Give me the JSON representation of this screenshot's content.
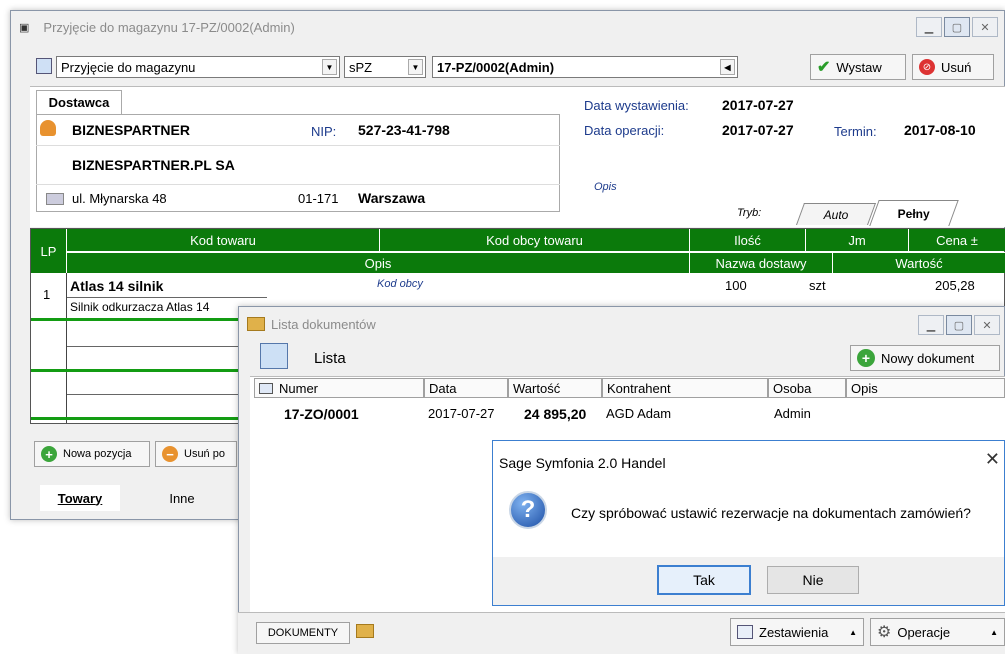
{
  "main_window": {
    "title": "Przyjęcie do magazynu 17-PZ/0002(Admin)",
    "doc_type": "Przyjęcie do magazynu",
    "series": "sPZ",
    "doc_number": "17-PZ/0002(Admin)",
    "issue_label": "Wystaw",
    "delete_label": "Usuń",
    "supplier": {
      "tab": "Dostawca",
      "name": "BIZNESPARTNER",
      "nip_label": "NIP:",
      "nip": "527-23-41-798",
      "full_name": "BIZNESPARTNER.PL SA",
      "street": "ul. Młynarska 48",
      "postcode": "01-171",
      "city": "Warszawa"
    },
    "dates": {
      "issue_label": "Data wystawienia:",
      "issue": "2017-07-27",
      "op_label": "Data operacji:",
      "op": "2017-07-27",
      "due_label": "Termin:",
      "due": "2017-08-10"
    },
    "desc_label": "Opis",
    "mode": {
      "label": "Tryb:",
      "tabs": [
        "Auto",
        "Pełny"
      ],
      "active": "Pełny"
    },
    "grid": {
      "lp": "LP",
      "h1": [
        "Kod towaru",
        "Kod obcy towaru",
        "Ilość",
        "Jm",
        "Cena ±"
      ],
      "h2": [
        "Opis",
        "Nazwa dostawy",
        "Wartość"
      ],
      "rows": [
        {
          "lp": "1",
          "code": "Atlas 14 silnik",
          "foreign": "Kod obcy",
          "qty": "100",
          "unit": "szt",
          "price": "205,28",
          "desc": "Silnik odkurzacza Atlas 14"
        }
      ]
    },
    "new_position": "Nowa pozycja",
    "remove_position": "Usuń po",
    "bottom_tabs": [
      "Towary",
      "Inne"
    ]
  },
  "list_window": {
    "title": "Lista dokumentów",
    "heading": "Lista",
    "new_doc": "Nowy dokument",
    "columns": [
      "Numer",
      "Data",
      "Wartość",
      "Kontrahent",
      "Osoba",
      "Opis"
    ],
    "rows": [
      {
        "numer": "17-ZO/0001",
        "data": "2017-07-27",
        "wartosc": "24 895,20",
        "kontrahent": "AGD Adam",
        "osoba": "Admin",
        "opis": ""
      }
    ],
    "status_docs": "DOKUMENTY",
    "reports": "Zestawienia",
    "operations": "Operacje"
  },
  "dialog": {
    "title": "Sage Symfonia 2.0 Handel",
    "message": "Czy spróbować ustawić rezerwacje na dokumentach zamówień?",
    "yes": "Tak",
    "no": "Nie"
  },
  "colors": {
    "grid_header": "#0b7a0b",
    "accent_blue": "#1d3b8c"
  }
}
